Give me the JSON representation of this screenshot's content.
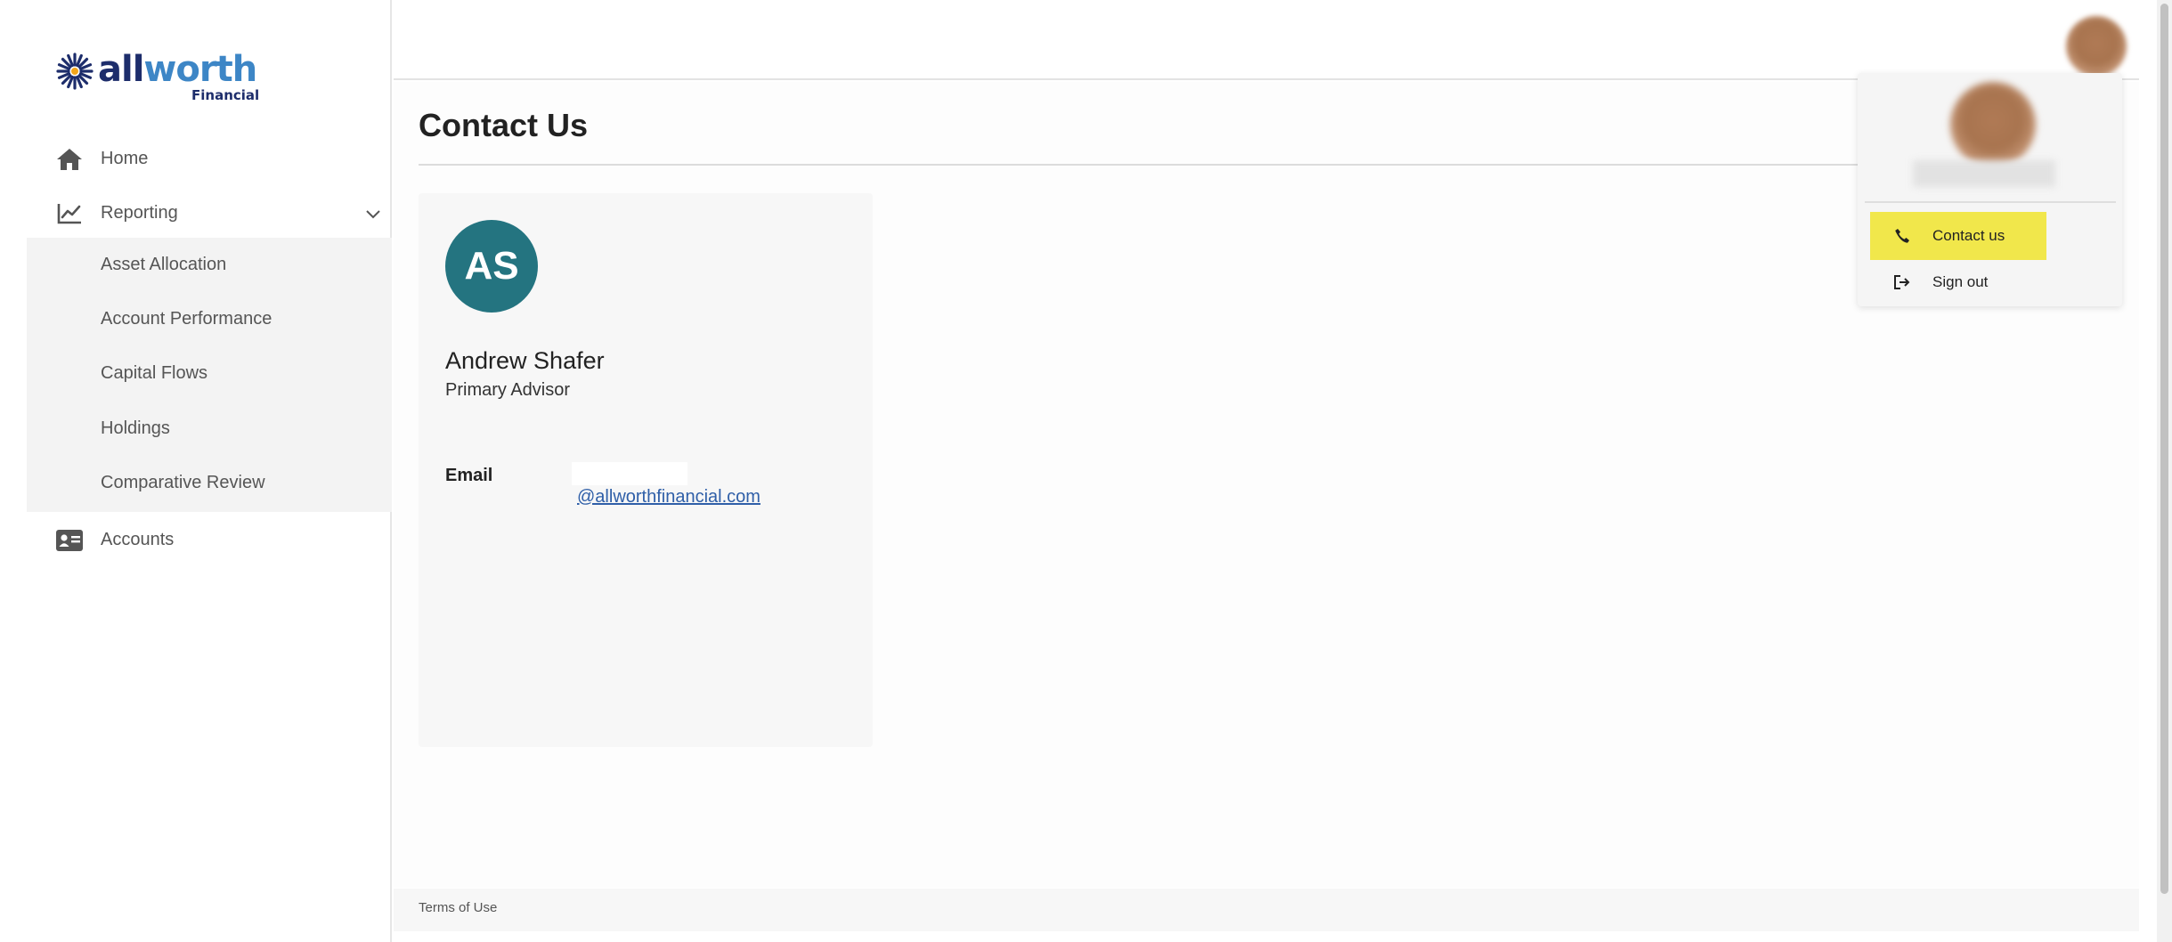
{
  "brand": {
    "name_part1": "all",
    "name_part2": "worth",
    "subtitle": "Financial"
  },
  "sidebar": {
    "items": [
      {
        "label": "Home",
        "icon": "home-icon"
      },
      {
        "label": "Reporting",
        "icon": "chart-line-icon",
        "expanded": true
      },
      {
        "label": "Accounts",
        "icon": "id-card-icon"
      }
    ],
    "reporting_subitems": [
      {
        "label": "Asset Allocation"
      },
      {
        "label": "Account Performance"
      },
      {
        "label": "Capital Flows"
      },
      {
        "label": "Holdings"
      },
      {
        "label": "Comparative Review"
      }
    ]
  },
  "page": {
    "title": "Contact Us"
  },
  "advisor": {
    "initials": "AS",
    "name": "Andrew Shafer",
    "role": "Primary Advisor",
    "email_label": "Email",
    "email_visible": "@allworthfinancial.com",
    "avatar_color": "#247480"
  },
  "user_menu": {
    "items": [
      {
        "label": "Contact us",
        "icon": "phone-icon",
        "highlighted": true
      },
      {
        "label": "Sign out",
        "icon": "sign-out-icon",
        "highlighted": false
      }
    ],
    "highlight_color": "#f1e74b"
  },
  "footer": {
    "terms": "Terms of Use"
  }
}
